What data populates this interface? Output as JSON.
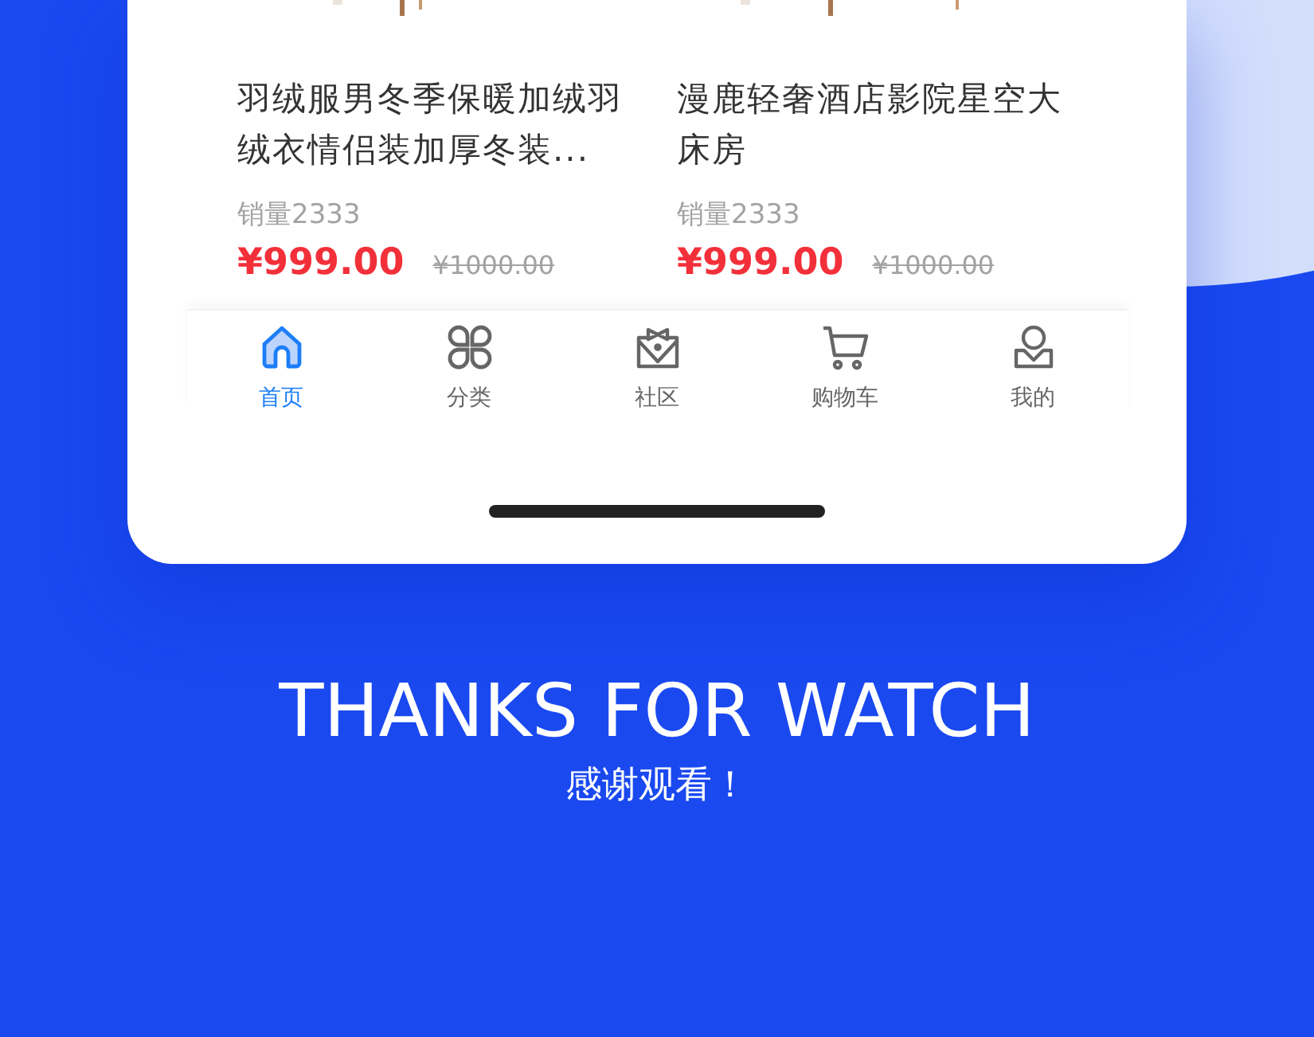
{
  "products": [
    {
      "title": "羽绒服男冬季保暖加绒羽绒衣情侣装加厚冬装...",
      "sales": "销量2333",
      "price": "¥999.00",
      "original_price": "¥1000.00"
    },
    {
      "title": "漫鹿轻奢酒店影院星空大床房",
      "sales": "销量2333",
      "price": "¥999.00",
      "original_price": "¥1000.00"
    }
  ],
  "tab_bar": [
    {
      "label": "首页",
      "selected": true
    },
    {
      "label": "分类",
      "selected": false
    },
    {
      "label": "社区",
      "selected": false
    },
    {
      "label": "购物车",
      "selected": false
    },
    {
      "label": "我的",
      "selected": false
    }
  ],
  "heading": "THANKS FOR WATCH",
  "subheading": "感谢观看！"
}
